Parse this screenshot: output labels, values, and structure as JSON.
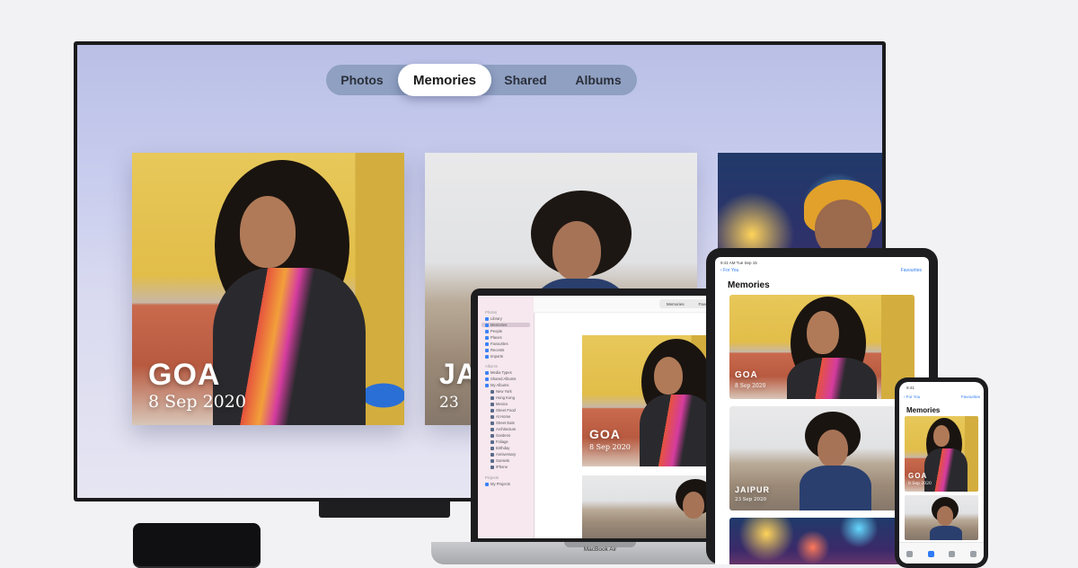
{
  "tv": {
    "tabs": [
      "Photos",
      "Memories",
      "Shared",
      "Albums"
    ],
    "selected_tab": "Memories",
    "memories": [
      {
        "title": "GOA",
        "date": "8 Sep 2020"
      },
      {
        "title": "JA",
        "date": "23"
      }
    ]
  },
  "mac": {
    "segments": [
      "Memories",
      "Favorites"
    ],
    "sidebar": {
      "section_photos": "Photos",
      "items": [
        "Library",
        "Memories",
        "People",
        "Places",
        "Favourites",
        "Recents",
        "Imports"
      ],
      "section_albums": "Albums",
      "album_items": [
        "Media Types",
        "Shared Albums",
        "My Albums",
        "New York",
        "Hong Kong",
        "Mexico",
        "Street Food",
        "At Home",
        "Street Eats",
        "Architecture",
        "Gardens",
        "Foliage",
        "Birthday",
        "Anniversary",
        "Sunsets",
        "iPhone"
      ],
      "section_projects": "Projects",
      "project_items": [
        "My Projects"
      ]
    },
    "memory": {
      "title": "GOA",
      "date": "8 Sep 2020"
    },
    "label": "MacBook Air"
  },
  "ipad": {
    "status_time": "9:41 AM  Tue Sep 15",
    "back_label": "For You",
    "right_label": "Favourites",
    "title": "Memories",
    "memories": [
      {
        "title": "GOA",
        "date": "8 Sep 2020"
      },
      {
        "title": "JAIPUR",
        "date": "23 Sep 2020"
      }
    ]
  },
  "iphone": {
    "status_time": "9:41",
    "back_label": "For You",
    "right_label": "Favourites",
    "title": "Memories",
    "memories": [
      {
        "title": "GOA",
        "date": "8 Sep 2020"
      }
    ]
  },
  "colors": {
    "accent": "#2f7bf5",
    "tab_pill": "#8fa0c2"
  }
}
